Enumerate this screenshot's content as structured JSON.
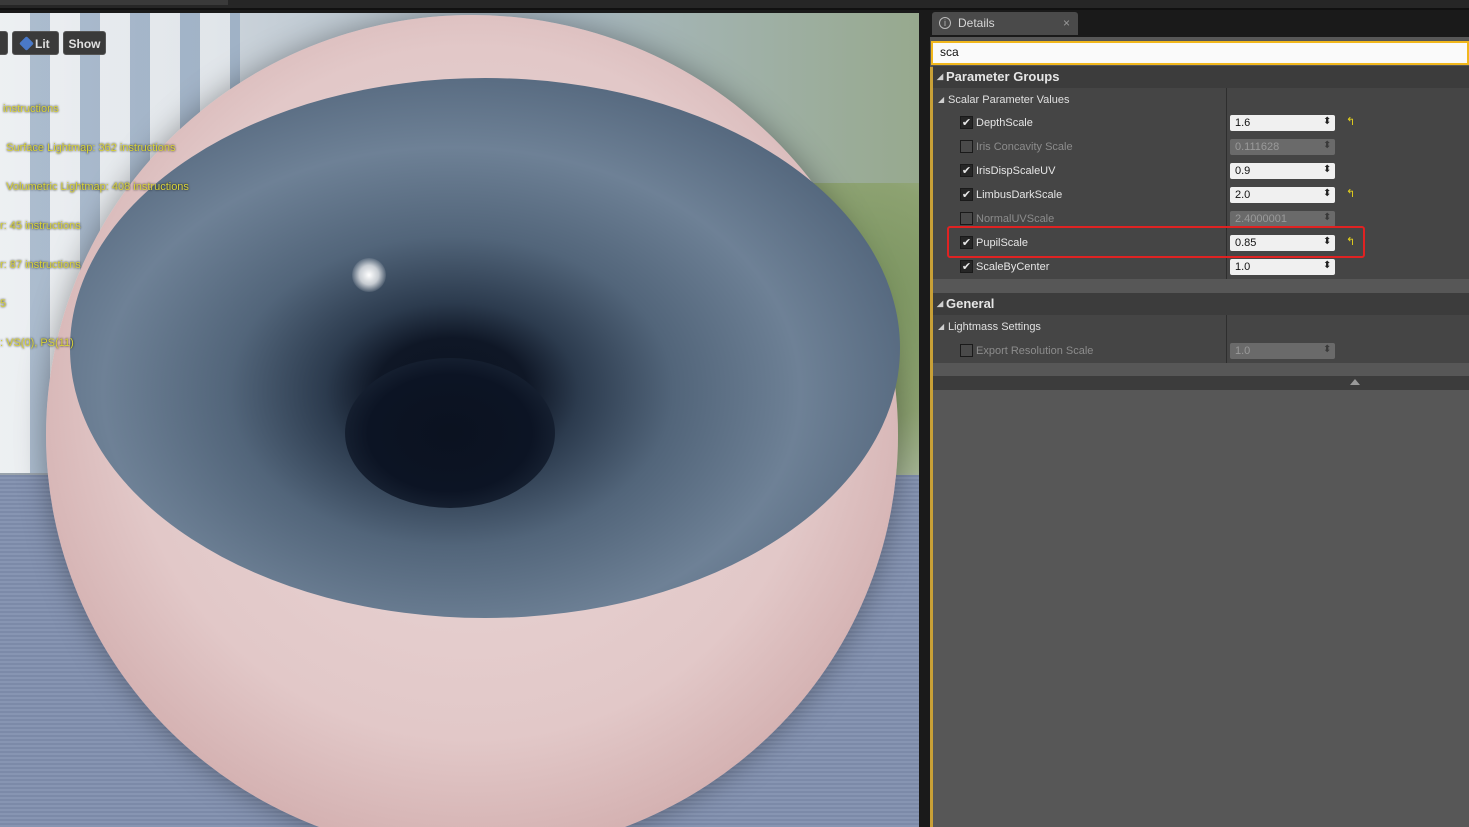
{
  "viewport": {
    "buttons": {
      "lit_label": "Lit",
      "show_label": "Show"
    },
    "stats": [
      " instructions",
      "  Surface Lightmap: 362 instructions",
      "  Volumetric Lightmap: 408 instructions",
      "r: 45 instructions",
      "r: 87 instructions",
      "5",
      ": VS(0), PS(11)"
    ]
  },
  "details": {
    "tab_label": "Details",
    "tab_close": "×",
    "search_value": "sca",
    "categories": {
      "parameter_groups": "Parameter Groups",
      "scalar_parameter_values": "Scalar Parameter Values",
      "general": "General",
      "lightmass_settings": "Lightmass Settings"
    },
    "params": [
      {
        "name": "DepthScale",
        "value": "1.6",
        "enabled": true,
        "reset": true
      },
      {
        "name": "Iris Concavity Scale",
        "value": "0.111628",
        "enabled": false,
        "reset": false
      },
      {
        "name": "IrisDispScaleUV",
        "value": "0.9",
        "enabled": true,
        "reset": false
      },
      {
        "name": "LimbusDarkScale",
        "value": "2.0",
        "enabled": true,
        "reset": true
      },
      {
        "name": "NormalUVScale",
        "value": "2.4000001",
        "enabled": false,
        "reset": false
      },
      {
        "name": "PupilScale",
        "value": "0.85",
        "enabled": true,
        "reset": true
      },
      {
        "name": "ScaleByCenter",
        "value": "1.0",
        "enabled": true,
        "reset": false
      }
    ],
    "lightmass_params": [
      {
        "name": "Export Resolution Scale",
        "value": "1.0",
        "enabled": false
      }
    ]
  },
  "icons": {
    "checkbox_checked": "✔",
    "spin": "⬍",
    "reset": "↰",
    "collapse": "◢"
  },
  "colors": {
    "accent": "#f1b71c",
    "highlight_box": "#e02222",
    "reset_arrow": "#e6d21c"
  }
}
